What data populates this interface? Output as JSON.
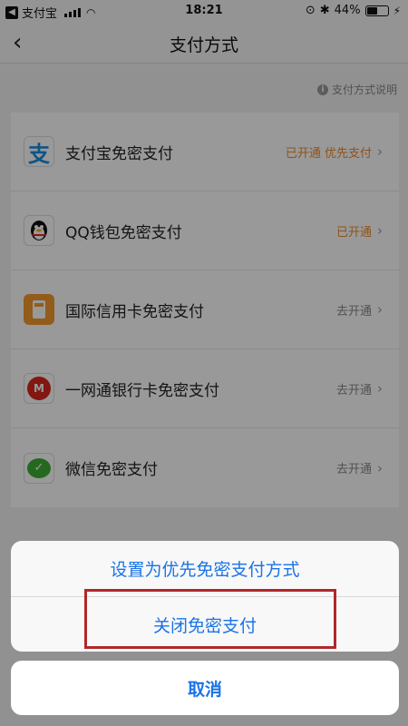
{
  "status_bar": {
    "carrier": "支付宝",
    "time": "18:21",
    "battery": "44%"
  },
  "nav": {
    "title": "支付方式"
  },
  "help": {
    "label": "支付方式说明"
  },
  "methods": [
    {
      "label": "支付宝免密支付",
      "status": "已开通 优先支付"
    },
    {
      "label": "QQ钱包免密支付",
      "status": "已开通"
    },
    {
      "label": "国际信用卡免密支付",
      "status": "去开通"
    },
    {
      "label": "一网通银行卡免密支付",
      "status": "去开通"
    },
    {
      "label": "微信免密支付",
      "status": "去开通"
    }
  ],
  "action_sheet": {
    "set_preferred": "设置为优先免密支付方式",
    "close": "关闭免密支付",
    "cancel": "取消"
  },
  "colors": {
    "accent": "#1a73e8",
    "active_status": "#f08a2c",
    "highlight": "#b1272a"
  }
}
